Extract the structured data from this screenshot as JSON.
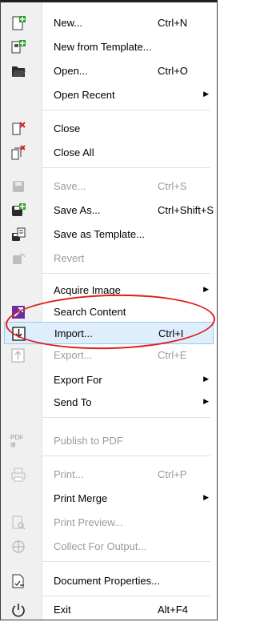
{
  "menu": {
    "items": [
      {
        "label": "New...",
        "shortcut": "Ctrl+N",
        "icon": "new-document-icon",
        "enabled": true
      },
      {
        "label": "New from Template...",
        "shortcut": "",
        "icon": "new-from-template-icon",
        "enabled": true
      },
      {
        "label": "Open...",
        "shortcut": "Ctrl+O",
        "icon": "open-folder-icon",
        "enabled": true
      },
      {
        "label": "Open Recent",
        "shortcut": "",
        "icon": "",
        "enabled": true,
        "submenu": true
      },
      {
        "label": "Close",
        "shortcut": "",
        "icon": "close-document-icon",
        "enabled": true
      },
      {
        "label": "Close All",
        "shortcut": "",
        "icon": "close-all-icon",
        "enabled": true
      },
      {
        "label": "Save...",
        "shortcut": "Ctrl+S",
        "icon": "save-icon",
        "enabled": false
      },
      {
        "label": "Save As...",
        "shortcut": "Ctrl+Shift+S",
        "icon": "save-as-icon",
        "enabled": true
      },
      {
        "label": "Save as Template...",
        "shortcut": "",
        "icon": "save-as-template-icon",
        "enabled": true
      },
      {
        "label": "Revert",
        "shortcut": "",
        "icon": "revert-icon",
        "enabled": false
      },
      {
        "label": "Acquire Image",
        "shortcut": "",
        "icon": "",
        "enabled": true,
        "submenu": true
      },
      {
        "label": "Search Content",
        "shortcut": "",
        "icon": "search-content-icon",
        "enabled": true
      },
      {
        "label": "Import...",
        "shortcut": "Ctrl+I",
        "icon": "import-icon",
        "enabled": true,
        "highlighted": true
      },
      {
        "label": "Export...",
        "shortcut": "Ctrl+E",
        "icon": "export-icon",
        "enabled": false
      },
      {
        "label": "Export For",
        "shortcut": "",
        "icon": "",
        "enabled": true,
        "submenu": true
      },
      {
        "label": "Send To",
        "shortcut": "",
        "icon": "",
        "enabled": true,
        "submenu": true
      },
      {
        "label": "Publish to PDF",
        "shortcut": "",
        "icon": "pdf-icon",
        "enabled": false
      },
      {
        "label": "Print...",
        "shortcut": "Ctrl+P",
        "icon": "print-icon",
        "enabled": false
      },
      {
        "label": "Print Merge",
        "shortcut": "",
        "icon": "",
        "enabled": true,
        "submenu": true
      },
      {
        "label": "Print Preview...",
        "shortcut": "",
        "icon": "print-preview-icon",
        "enabled": false
      },
      {
        "label": "Collect For Output...",
        "shortcut": "",
        "icon": "collect-for-output-icon",
        "enabled": false
      },
      {
        "label": "Document Properties...",
        "shortcut": "",
        "icon": "document-properties-icon",
        "enabled": true
      },
      {
        "label": "Exit",
        "shortcut": "Alt+F4",
        "icon": "exit-icon",
        "enabled": true
      }
    ]
  },
  "colors": {
    "highlight_bg": "#dfeefc",
    "highlight_border": "#9cc6ee",
    "annotation": "#e01b1b",
    "accent_green": "#2e9e2e",
    "accent_purple": "#6b2fa0"
  }
}
